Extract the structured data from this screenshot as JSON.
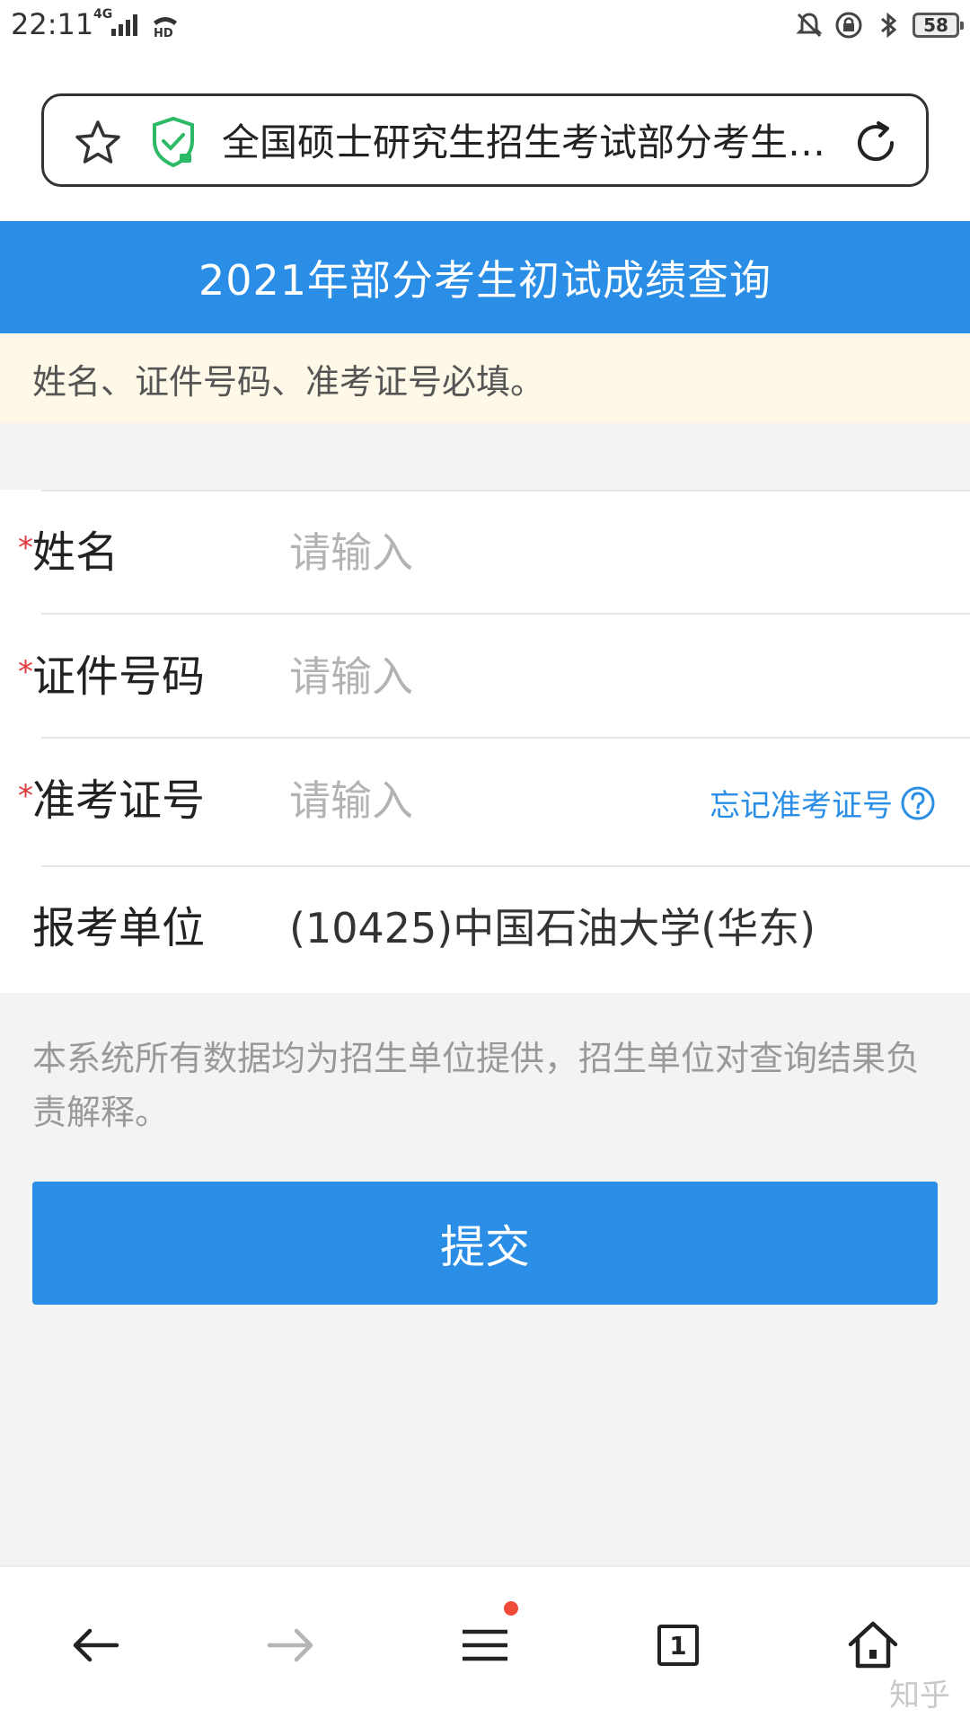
{
  "status_bar": {
    "time": "22:11",
    "network": "4G",
    "battery": "58",
    "icons": [
      "signal-icon",
      "hd-call-icon",
      "mute-bell-icon",
      "rotation-lock-icon",
      "bluetooth-icon",
      "battery-icon"
    ]
  },
  "address_bar": {
    "text": "全国硕士研究生招生考试部分考生…",
    "icons": [
      "star-icon",
      "shield-check-icon",
      "reload-icon"
    ]
  },
  "page": {
    "title": "2021年部分考生初试成绩查询",
    "notice": "姓名、证件号码、准考证号必填。"
  },
  "form": {
    "required_mark": "*",
    "fields": [
      {
        "label": "姓名",
        "placeholder": "请输入"
      },
      {
        "label": "证件号码",
        "placeholder": "请输入"
      },
      {
        "label": "准考证号",
        "placeholder": "请输入"
      },
      {
        "label": "报考单位",
        "value": "(10425)中国石油大学(华东)"
      }
    ],
    "forgot_link": "忘记准考证号"
  },
  "disclaimer": "本系统所有数据均为招生单位提供，招生单位对查询结果负责解释。",
  "submit_label": "提交",
  "bottom_nav": {
    "items": [
      "back-arrow-icon",
      "forward-arrow-icon",
      "menu-icon",
      "tabs-icon",
      "home-icon"
    ],
    "tab_count": "1"
  },
  "watermark": "知乎",
  "colors": {
    "primary": "#2a8ee6",
    "required": "#e03b3b",
    "notice_bg": "#fdf8e7",
    "page_bg": "#f3f3f3"
  }
}
